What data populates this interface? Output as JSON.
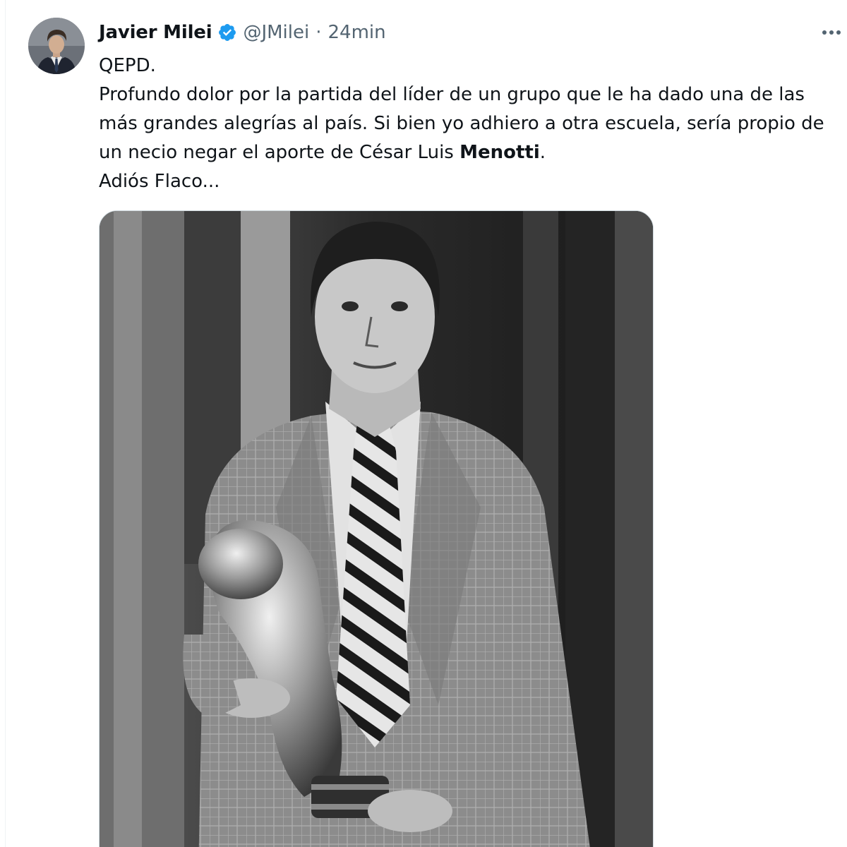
{
  "tweet": {
    "author": {
      "display_name": "Javier Milei",
      "handle": "@JMilei",
      "verified": true,
      "avatar_icon": "profile-photo-avatar"
    },
    "separator": "·",
    "timestamp": "24min",
    "more_icon": "more-options-icon",
    "text": {
      "line1": "QEPD.",
      "line2_part1": "Profundo dolor por la partida del líder de un grupo que le ha dado una de las más grandes alegrías al país. Si bien yo adhiero a otra escuela, sería propio de un necio negar el aporte de César Luis ",
      "line2_bold": "Menotti",
      "line2_part2": ".",
      "line3": "Adiós Flaco..."
    },
    "media": {
      "type": "photo",
      "style": "black-and-white"
    }
  },
  "colors": {
    "text_primary": "#0f1419",
    "text_secondary": "#536471",
    "verified_blue": "#1d9bf0",
    "border": "#cfd9de"
  }
}
